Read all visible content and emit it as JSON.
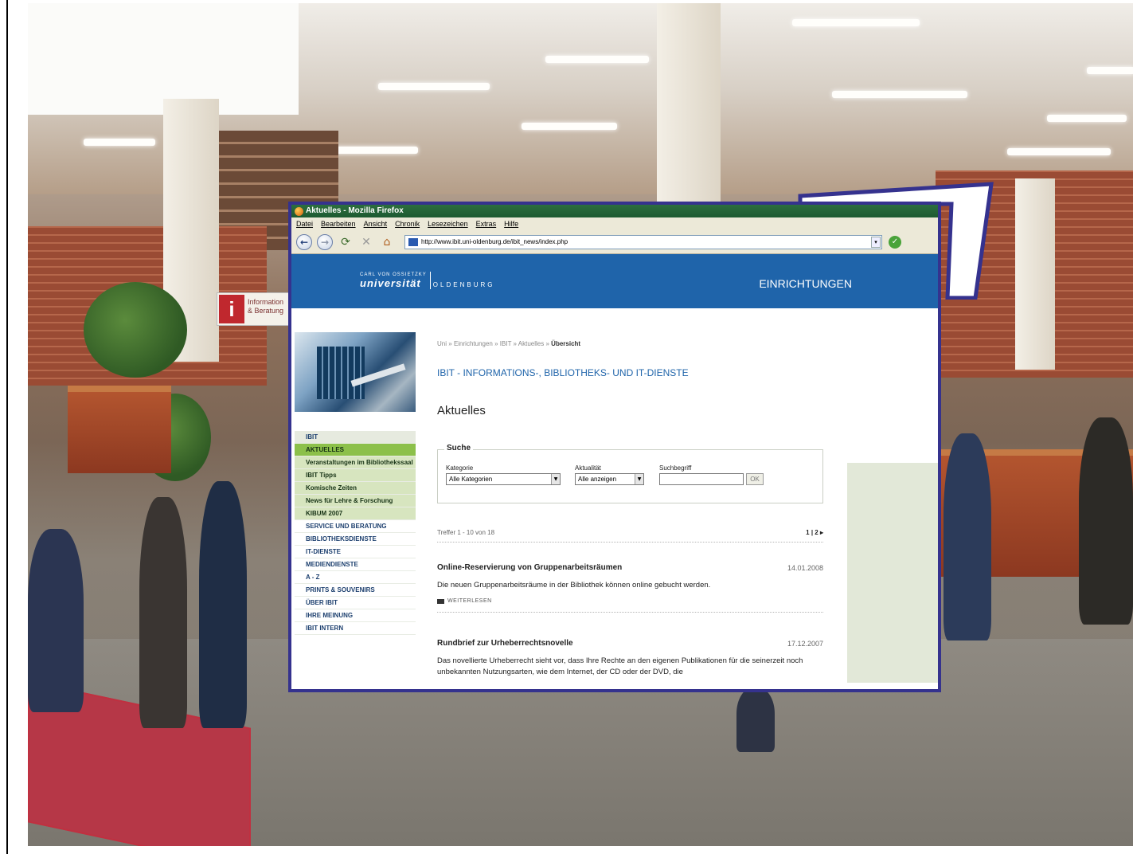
{
  "browser": {
    "window_title": "Aktuelles - Mozilla Firefox",
    "menu": [
      "Datei",
      "Bearbeiten",
      "Ansicht",
      "Chronik",
      "Lesezeichen",
      "Extras",
      "Hilfe"
    ],
    "url": "http://www.ibit.uni-oldenburg.de/ibit_news/index.php",
    "icons": {
      "back": "back-arrow-icon",
      "forward": "forward-arrow-icon",
      "reload": "reload-icon",
      "stop": "stop-icon",
      "home": "home-icon",
      "go": "go-check-icon"
    }
  },
  "site": {
    "logo": {
      "carl_von_ossietzky": "CARL VON OSSIETZKY",
      "universitaet": "universität",
      "oldenburg": "OLDENBURG"
    },
    "section_title": "EINRICHTUNGEN",
    "breadcrumb": {
      "items": [
        "Uni",
        "Einrichtungen",
        "IBIT",
        "Aktuelles"
      ],
      "separator": "»",
      "current": "Übersicht"
    },
    "institution_title": "IBIT - INFORMATIONS-, BIBLIOTHEKS- UND IT-DIENSTE",
    "page_heading": "Aktuelles"
  },
  "sidebar": {
    "items": [
      {
        "label": "IBIT",
        "state": "top"
      },
      {
        "label": "AKTUELLES",
        "state": "active"
      },
      {
        "label": "Veranstaltungen im Bibliothekssaal",
        "state": "sub"
      },
      {
        "label": "IBIT Tipps",
        "state": "sub"
      },
      {
        "label": "Komische Zeiten",
        "state": "sub"
      },
      {
        "label": "News für Lehre & Forschung",
        "state": "sub"
      },
      {
        "label": "KIBUM 2007",
        "state": "sub"
      },
      {
        "label": "SERVICE UND BERATUNG",
        "state": "normal"
      },
      {
        "label": "BIBLIOTHEKSDIENSTE",
        "state": "normal"
      },
      {
        "label": "IT-DIENSTE",
        "state": "normal"
      },
      {
        "label": "MEDIENDIENSTE",
        "state": "normal"
      },
      {
        "label": "A - Z",
        "state": "normal"
      },
      {
        "label": "PRINTS & SOUVENIRS",
        "state": "normal"
      },
      {
        "label": "ÜBER IBIT",
        "state": "normal"
      },
      {
        "label": "IHRE MEINUNG",
        "state": "normal"
      },
      {
        "label": "IBIT INTERN",
        "state": "normal"
      }
    ]
  },
  "search": {
    "legend": "Suche",
    "kategorie_label": "Kategorie",
    "kategorie_value": "Alle Kategorien",
    "aktualitaet_label": "Aktualität",
    "aktualitaet_value": "Alle anzeigen",
    "suchbegriff_label": "Suchbegriff",
    "suchbegriff_value": "",
    "ok_label": "OK"
  },
  "results": {
    "summary": "Treffer 1 - 10 von 18",
    "pager": "1 | 2 ▸"
  },
  "news": [
    {
      "title": "Online-Reservierung von Gruppenarbeitsräumen",
      "date": "14.01.2008",
      "text": "Die neuen Gruppenarbeitsräume in der Bibliothek können online gebucht werden.",
      "read_more": "WEITERLESEN"
    },
    {
      "title": "Rundbrief zur Urheberrechtsnovelle",
      "date": "17.12.2007",
      "text": "Das novellierte Urheberrecht sieht vor, dass Ihre Rechte an den eigenen Publikationen für die seinerzeit noch unbekannten Nutzungsarten, wie dem Internet, der CD oder der DVD, die"
    }
  ],
  "photo": {
    "info_sign_letter": "i",
    "info_sign_text": "Information & Beratung"
  },
  "colors": {
    "header_blue": "#1f64aa",
    "frame_blue": "#35328e",
    "nav_active_green": "#8cc04a",
    "nav_sub_green": "#d7e5bf",
    "titlebar_green": "#1d5a31"
  }
}
